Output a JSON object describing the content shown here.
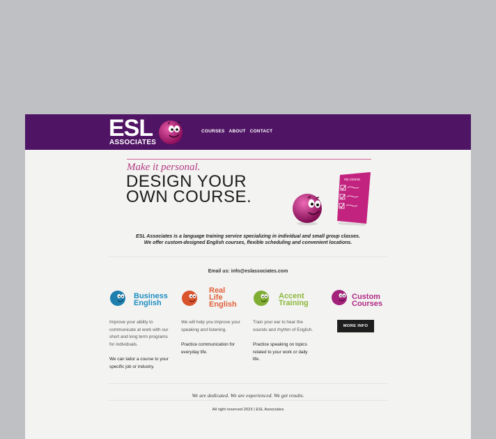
{
  "header": {
    "logo_main": "ESL",
    "logo_sub": "ASSOCIATES",
    "nav": [
      "COURSES",
      "ABOUT",
      "CONTACT"
    ]
  },
  "hero": {
    "tagline": "Make it personal.",
    "headline_1": "DESIGN YOUR",
    "headline_2": "OWN COURSE.",
    "sheet_label": "my course"
  },
  "intro": {
    "line1": "ESL Associates is a language training service specializing in individual and small group classes.",
    "line2": "We offer custom-designed English courses, flexible scheduling and convenient locations."
  },
  "contact": {
    "email_label": "Email us:",
    "email": "info@eslassociates.com"
  },
  "columns": [
    {
      "title_1": "Business",
      "title_2": "English",
      "title_3": "",
      "color": "#1f8fc2",
      "p1": [
        "Improve your ability to",
        "communicate at work with our",
        "short and long term programs",
        "for individuals."
      ],
      "p2": [
        "We can tailor a course to your",
        "specific job or industry."
      ]
    },
    {
      "title_1": "Real",
      "title_2": "Life",
      "title_3": "English",
      "color": "#e0613c",
      "p1": [
        "We will help you improve your",
        "speaking and listening."
      ],
      "p2": [
        "Practice communication for",
        "everyday life."
      ]
    },
    {
      "title_1": "Accent",
      "title_2": "Training",
      "title_3": "",
      "color": "#8cb83c",
      "p1": [
        "Train your ear to hear the",
        "sounds and rhythm of English."
      ],
      "p2": [
        "Practice speaking on topics",
        "related to your work or daily",
        "life."
      ]
    },
    {
      "title_1": "Custom",
      "title_2": "Courses",
      "title_3": "",
      "color": "#b02a86",
      "button": "MORE INFO"
    }
  ],
  "footer": {
    "slogan": "We are dedicated. We are experienced. We get results.",
    "copyright": "All right reserved 2023 | ESL Associates"
  },
  "colors": {
    "header_bg": "#4f1464",
    "page_bg": "#f3f3f1",
    "accent_pink": "#b23a82"
  }
}
